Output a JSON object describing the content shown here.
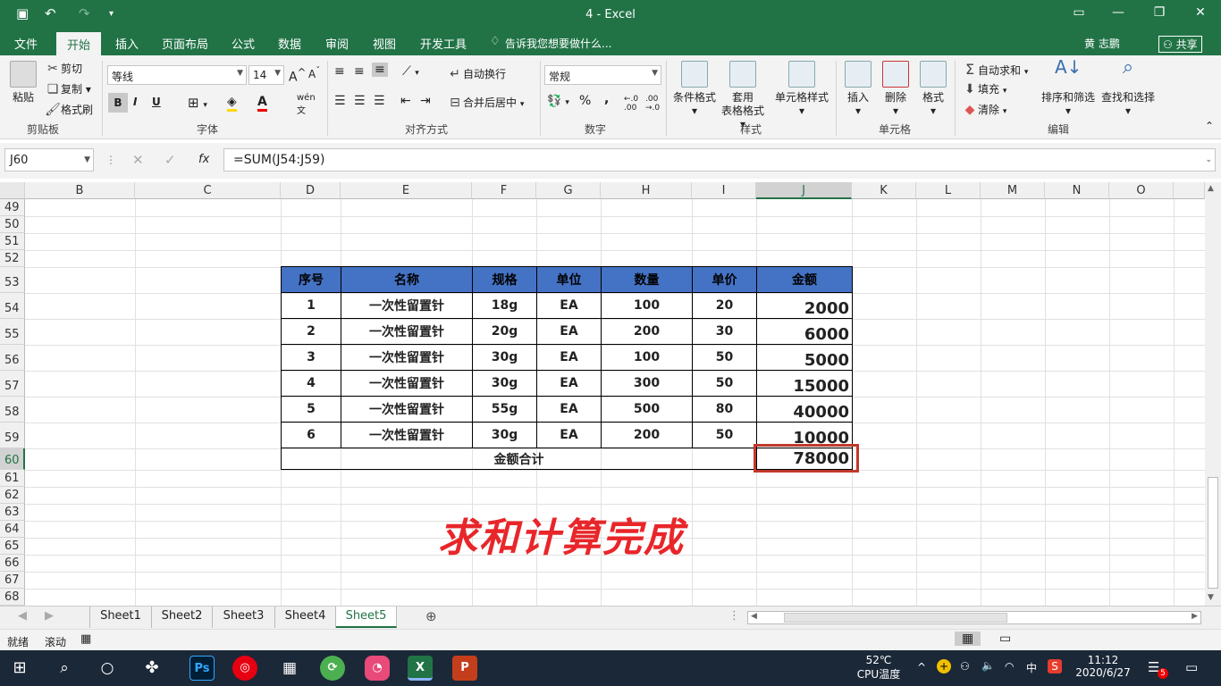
{
  "window": {
    "title": "4 - Excel",
    "user": "黄 志鹏",
    "share": "共享"
  },
  "tabs": [
    "文件",
    "开始",
    "插入",
    "页面布局",
    "公式",
    "数据",
    "审阅",
    "视图",
    "开发工具"
  ],
  "tell_me": "告诉我您想要做什么...",
  "ribbon": {
    "clipboard": {
      "paste": "粘贴",
      "cut": "剪切",
      "copy": "复制",
      "format_painter": "格式刷",
      "group": "剪贴板"
    },
    "font": {
      "name": "等线",
      "size": "14",
      "bold": "B",
      "italic": "I",
      "underline": "U",
      "group": "字体"
    },
    "alignment": {
      "wrap": "自动换行",
      "merge": "合并后居中",
      "group": "对齐方式"
    },
    "number": {
      "format": "常规",
      "percent": "%",
      "comma": ",",
      "group": "数字"
    },
    "styles": {
      "conditional": "条件格式",
      "table_line1": "套用",
      "table_line2": "表格格式",
      "cell_styles": "单元格样式",
      "group": "样式"
    },
    "cells": {
      "insert": "插入",
      "delete": "删除",
      "format": "格式",
      "group": "单元格"
    },
    "editing": {
      "autosum": "自动求和",
      "fill": "填充",
      "clear": "清除",
      "sort": "排序和筛选",
      "find": "查找和选择",
      "group": "编辑"
    }
  },
  "formula_bar": {
    "name_box": "J60",
    "fx": "fx",
    "formula": "=SUM(J54:J59)"
  },
  "columns": [
    "B",
    "C",
    "D",
    "E",
    "F",
    "G",
    "H",
    "I",
    "J",
    "K",
    "L",
    "M",
    "N",
    "O"
  ],
  "rows": [
    "49",
    "50",
    "51",
    "52",
    "53",
    "54",
    "55",
    "56",
    "57",
    "58",
    "59",
    "60",
    "61",
    "62",
    "63",
    "64",
    "65",
    "66",
    "67",
    "68"
  ],
  "table": {
    "headers": [
      "序号",
      "名称",
      "规格",
      "单位",
      "数量",
      "单价",
      "金额"
    ],
    "rows": [
      [
        "1",
        "一次性留置针",
        "18g",
        "EA",
        "100",
        "20",
        "2000"
      ],
      [
        "2",
        "一次性留置针",
        "20g",
        "EA",
        "200",
        "30",
        "6000"
      ],
      [
        "3",
        "一次性留置针",
        "30g",
        "EA",
        "100",
        "50",
        "5000"
      ],
      [
        "4",
        "一次性留置针",
        "30g",
        "EA",
        "300",
        "50",
        "15000"
      ],
      [
        "5",
        "一次性留置针",
        "55g",
        "EA",
        "500",
        "80",
        "40000"
      ],
      [
        "6",
        "一次性留置针",
        "30g",
        "EA",
        "200",
        "50",
        "10000"
      ]
    ],
    "total_label": "金额合计",
    "total_value": "78000"
  },
  "overlay_text": "求和计算完成",
  "sheets": [
    "Sheet1",
    "Sheet2",
    "Sheet3",
    "Sheet4",
    "Sheet5"
  ],
  "active_sheet": "Sheet5",
  "status": {
    "ready": "就绪",
    "scroll": "滚动"
  },
  "taskbar": {
    "temp": "52℃",
    "temp_label": "CPU温度",
    "ime": "中",
    "time": "11:12",
    "date": "2020/6/27",
    "notif": "5"
  },
  "colors": {
    "excel_green": "#217346",
    "header_blue": "#4472c4",
    "highlight_red": "#c0392b",
    "overlay_red": "#e8262a"
  }
}
